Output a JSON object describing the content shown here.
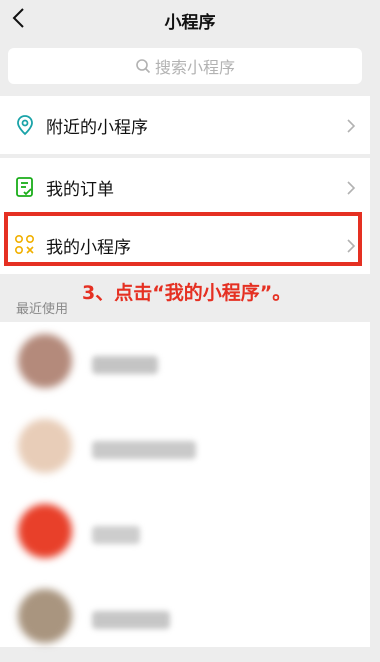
{
  "header": {
    "title": "小程序"
  },
  "search": {
    "placeholder": "搜索小程序"
  },
  "menu": {
    "nearby_label": "附近的小程序",
    "orders_label": "我的订单",
    "my_miniprograms_label": "我的小程序"
  },
  "annotation": {
    "text": "3、点击“我的小程序”。"
  },
  "recent": {
    "title": "最近使用",
    "items": [
      {
        "avatar_color": "#b48a7b"
      },
      {
        "avatar_color": "#e8cdb8"
      },
      {
        "avatar_color": "#e8402a"
      },
      {
        "avatar_color": "#a9957f"
      }
    ]
  },
  "colors": {
    "accent_green": "#1aad19",
    "icon_yellow": "#f1b000",
    "annotation_red": "#e53022",
    "background": "#ededed"
  },
  "icons": [
    "back-chevron-icon",
    "search-icon",
    "location-pin-icon",
    "order-list-icon",
    "mini-program-icon",
    "chevron-right-icon"
  ]
}
